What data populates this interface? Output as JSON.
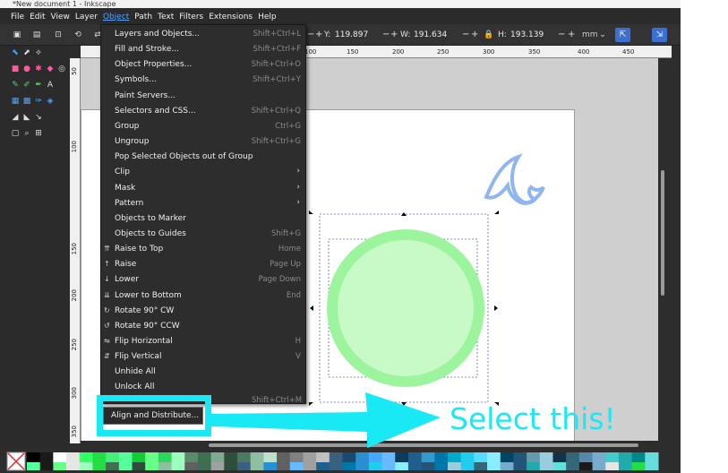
{
  "window": {
    "title": "*New document 1 - Inkscape"
  },
  "menubar": {
    "items": [
      "File",
      "Edit",
      "View",
      "Layer",
      "Object",
      "Path",
      "Text",
      "Filters",
      "Extensions",
      "Help"
    ]
  },
  "toolbar": {
    "y_label": "Y:",
    "y_value": "119.897",
    "w_label": "W:",
    "w_value": "191.634",
    "h_label": "H:",
    "h_value": "193.139",
    "units": "mm"
  },
  "rulers": {
    "top": [
      "100",
      "150",
      "200",
      "250",
      "300",
      "350",
      "400",
      "450"
    ],
    "left": [
      "50",
      "100",
      "150",
      "200",
      "250",
      "300",
      "350"
    ]
  },
  "object_menu": [
    {
      "label": "Layers and Objects...",
      "shortcut": "Shift+Ctrl+L"
    },
    {
      "label": "Fill and Stroke...",
      "shortcut": "Shift+Ctrl+F"
    },
    {
      "label": "Object Properties...",
      "shortcut": "Shift+Ctrl+O"
    },
    {
      "label": "Symbols...",
      "shortcut": "Shift+Ctrl+Y"
    },
    {
      "label": "Paint Servers...",
      "shortcut": ""
    },
    {
      "label": "Selectors and CSS...",
      "shortcut": "Shift+Ctrl+Q"
    },
    {
      "label": "Group",
      "shortcut": "Ctrl+G"
    },
    {
      "label": "Ungroup",
      "shortcut": "Shift+Ctrl+G"
    },
    {
      "label": "Pop Selected Objects out of Group",
      "shortcut": ""
    },
    {
      "label": "Clip",
      "shortcut": "",
      "submenu": true
    },
    {
      "label": "Mask",
      "shortcut": "",
      "submenu": true
    },
    {
      "label": "Pattern",
      "shortcut": "",
      "submenu": true
    },
    {
      "label": "Objects to Marker",
      "shortcut": ""
    },
    {
      "label": "Objects to Guides",
      "shortcut": "Shift+G"
    },
    {
      "label": "Raise to Top",
      "shortcut": "Home",
      "icon": "raise-top-icon"
    },
    {
      "label": "Raise",
      "shortcut": "Page Up",
      "icon": "raise-icon"
    },
    {
      "label": "Lower",
      "shortcut": "Page Down",
      "icon": "lower-icon"
    },
    {
      "label": "Lower to Bottom",
      "shortcut": "End",
      "icon": "lower-bottom-icon"
    },
    {
      "label": "Rotate 90° CW",
      "shortcut": "",
      "icon": "rotate-cw-icon"
    },
    {
      "label": "Rotate 90° CCW",
      "shortcut": "",
      "icon": "rotate-ccw-icon"
    },
    {
      "label": "Flip Horizontal",
      "shortcut": "H",
      "icon": "flip-horizontal-icon"
    },
    {
      "label": "Flip Vertical",
      "shortcut": "V",
      "icon": "flip-vertical-icon"
    },
    {
      "label": "Unhide All",
      "shortcut": ""
    },
    {
      "label": "Unlock All",
      "shortcut": ""
    }
  ],
  "align_item": {
    "label": "Align and Distribute...",
    "shortcut": "Shift+Ctrl+M"
  },
  "annotation": {
    "text": "Select this!",
    "color": "#19e9f5"
  },
  "colors": {
    "accent": "#4ea3ff",
    "circle_fill": "#c8fac8",
    "circle_stroke": "#9cf59c",
    "logo": "#8fb6f0"
  },
  "palette": [
    "#000000",
    "#1a1a1a",
    "#ffffff",
    "#e6e6e6",
    "#33ff66",
    "#22dd44",
    "#44ee77",
    "#55ff99",
    "#11cc33",
    "#66ff88",
    "#2bd95a",
    "#99ffbb",
    "#5c8a6b",
    "#3f6f52",
    "#7faa8d",
    "#2e4d3a",
    "#4a7a5f",
    "#8fbfa0",
    "#c0e0cc",
    "#606060",
    "#808080",
    "#a0a0a0",
    "#c0c0c0",
    "#3a6080",
    "#1c4a6e",
    "#2a8fd0",
    "#44aaff",
    "#66bbff",
    "#0d3b5c",
    "#1f5f8b",
    "#3399cc",
    "#0077aa",
    "#00aacc",
    "#22ccee",
    "#55ddff",
    "#88eeff",
    "#004466",
    "#225577",
    "#6699aa",
    "#99ccdd",
    "#113344",
    "#336677",
    "#5588aa",
    "#77aacc",
    "#44cccc",
    "#22aaaa",
    "#008888",
    "#66dddd"
  ]
}
